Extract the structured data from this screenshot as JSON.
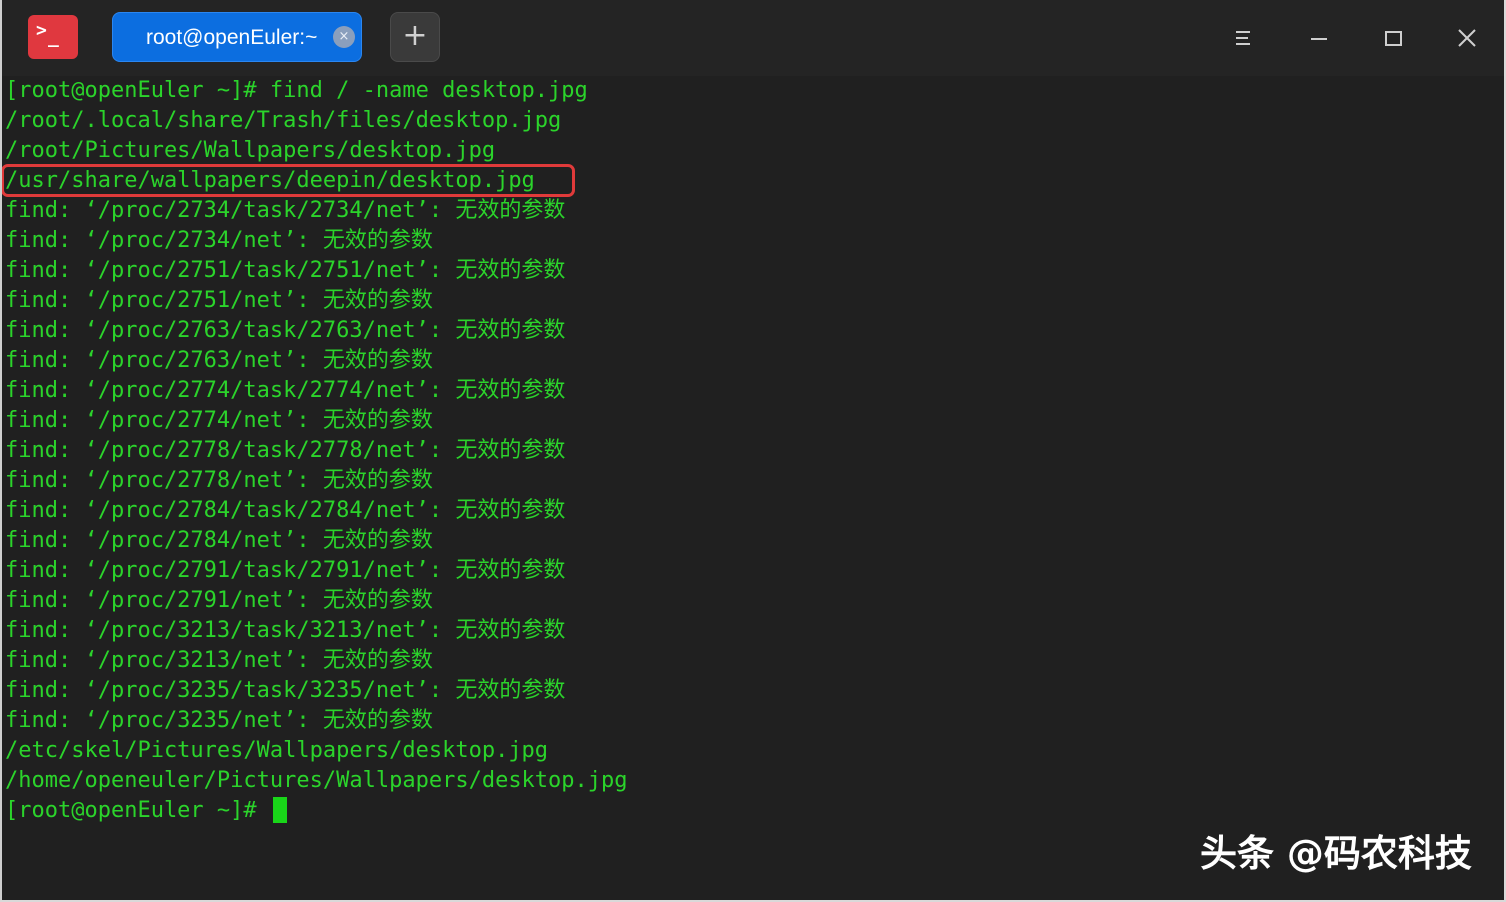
{
  "titlebar": {
    "app_icon": "terminal-prompt-icon",
    "tab_title": "root@openEuler:~",
    "tab_close_glyph": "×",
    "new_tab_glyph": "+",
    "menu_icon": "hamburger-menu-icon",
    "minimize_icon": "minimize-icon",
    "maximize_icon": "maximize-icon",
    "close_icon": "close-icon"
  },
  "terminal": {
    "lines": [
      "[root@openEuler ~]# find / -name desktop.jpg",
      "/root/.local/share/Trash/files/desktop.jpg",
      "/root/Pictures/Wallpapers/desktop.jpg",
      "/usr/share/wallpapers/deepin/desktop.jpg",
      "find: ‘/proc/2734/task/2734/net’: 无效的参数",
      "find: ‘/proc/2734/net’: 无效的参数",
      "find: ‘/proc/2751/task/2751/net’: 无效的参数",
      "find: ‘/proc/2751/net’: 无效的参数",
      "find: ‘/proc/2763/task/2763/net’: 无效的参数",
      "find: ‘/proc/2763/net’: 无效的参数",
      "find: ‘/proc/2774/task/2774/net’: 无效的参数",
      "find: ‘/proc/2774/net’: 无效的参数",
      "find: ‘/proc/2778/task/2778/net’: 无效的参数",
      "find: ‘/proc/2778/net’: 无效的参数",
      "find: ‘/proc/2784/task/2784/net’: 无效的参数",
      "find: ‘/proc/2784/net’: 无效的参数",
      "find: ‘/proc/2791/task/2791/net’: 无效的参数",
      "find: ‘/proc/2791/net’: 无效的参数",
      "find: ‘/proc/3213/task/3213/net’: 无效的参数",
      "find: ‘/proc/3213/net’: 无效的参数",
      "find: ‘/proc/3235/task/3235/net’: 无效的参数",
      "find: ‘/proc/3235/net’: 无效的参数",
      "/etc/skel/Pictures/Wallpapers/desktop.jpg",
      "/home/openeuler/Pictures/Wallpapers/desktop.jpg",
      "[root@openEuler ~]# "
    ],
    "text_color": "#2bd42b",
    "background_color": "#202020",
    "highlight_color": "#e03a3a"
  },
  "watermark": {
    "text": "头条 @码农科技"
  },
  "colors": {
    "titlebar_bg": "#242424",
    "tab_active_bg": "#0c6ee0",
    "app_icon_bg": "#e0383f"
  }
}
